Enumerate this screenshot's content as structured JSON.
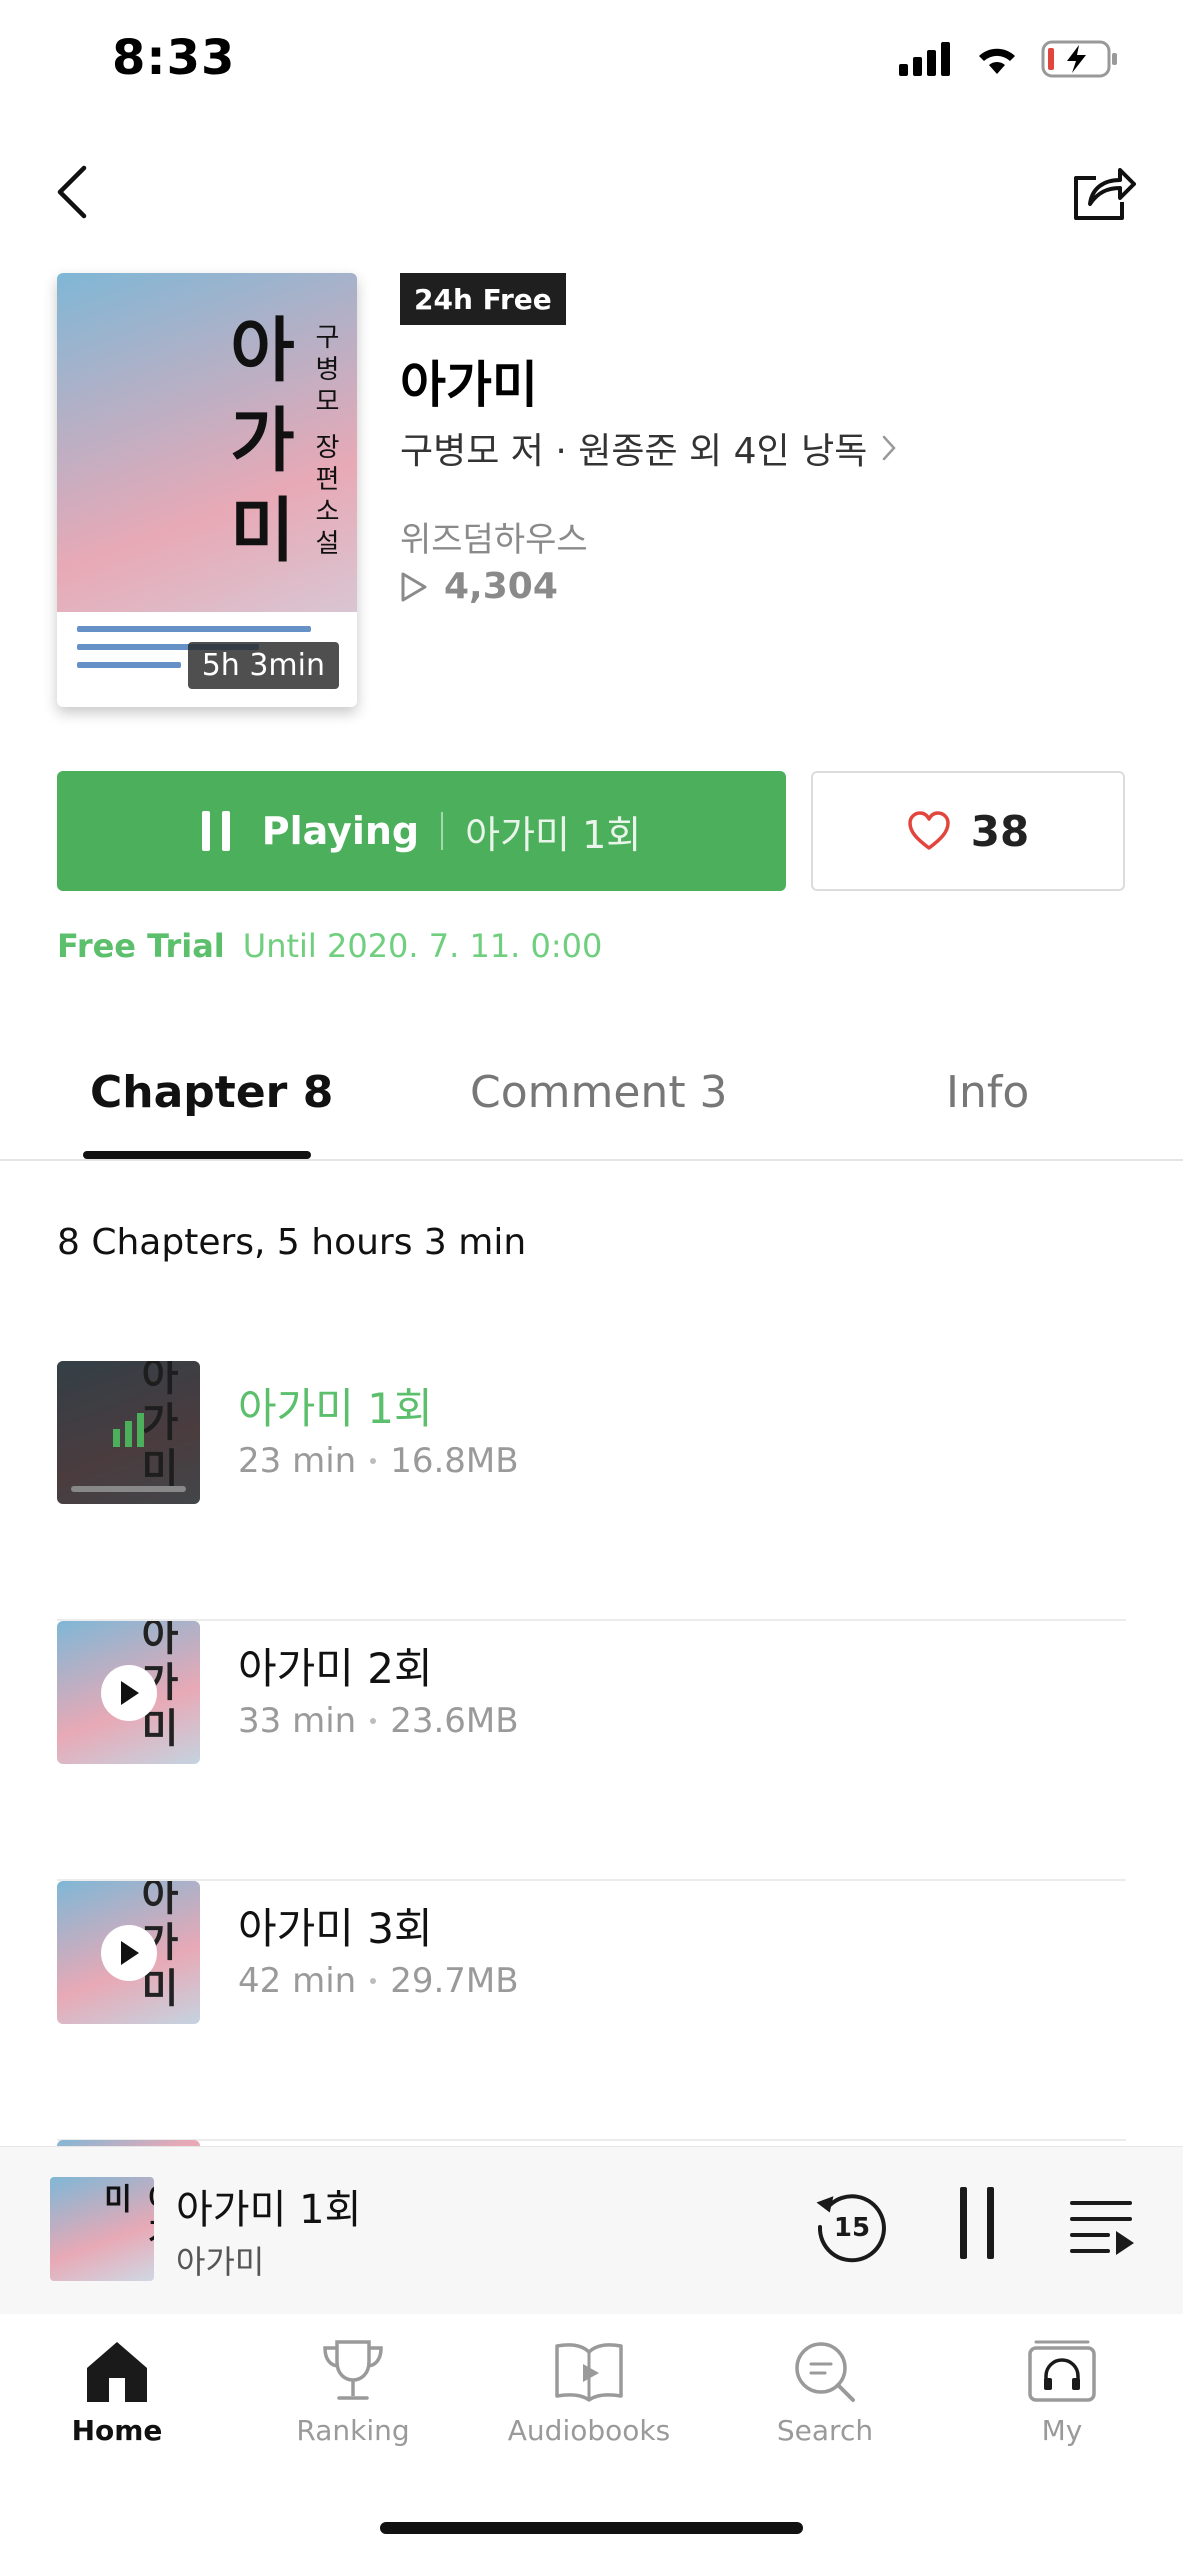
{
  "status_bar": {
    "time": "8:33"
  },
  "book": {
    "badge": "24h Free",
    "title": "아가미",
    "author_line": "구병모 저 · 원종준 외 4인 낭독",
    "publisher": "위즈덤하우스",
    "play_count": "4,304",
    "duration": "5h 3min",
    "cover_title": "아가미",
    "cover_subtitle": "구병모 장편소설"
  },
  "actions": {
    "playing_label": "Playing",
    "playing_chapter": "아가미 1회",
    "like_count": "38"
  },
  "trial": {
    "label": "Free Trial",
    "date": "Until 2020. 7. 11. 0:00"
  },
  "tabs": [
    {
      "label": "Chapter 8"
    },
    {
      "label": "Comment 3"
    },
    {
      "label": "Info"
    }
  ],
  "summary": "8 Chapters, 5 hours 3 min",
  "chapters": [
    {
      "title": "아가미 1회",
      "duration": "23 min",
      "size": "16.8MB",
      "state": "playing"
    },
    {
      "title": "아가미 2회",
      "duration": "33 min",
      "size": "23.6MB",
      "state": "idle"
    },
    {
      "title": "아가미 3회",
      "duration": "42 min",
      "size": "29.7MB",
      "state": "idle"
    }
  ],
  "mini_player": {
    "title": "아가미 1회",
    "subtitle": "아가미",
    "rewind_seconds": "15"
  },
  "tabbar": [
    {
      "label": "Home",
      "icon": "home-icon",
      "active": true
    },
    {
      "label": "Ranking",
      "icon": "trophy-icon"
    },
    {
      "label": "Audiobooks",
      "icon": "book-icon"
    },
    {
      "label": "Search",
      "icon": "search-icon"
    },
    {
      "label": "My",
      "icon": "headphones-icon"
    }
  ],
  "colors": {
    "accent": "#4caf5b",
    "accent_text": "#5cbf6c",
    "like": "#e2453c"
  }
}
